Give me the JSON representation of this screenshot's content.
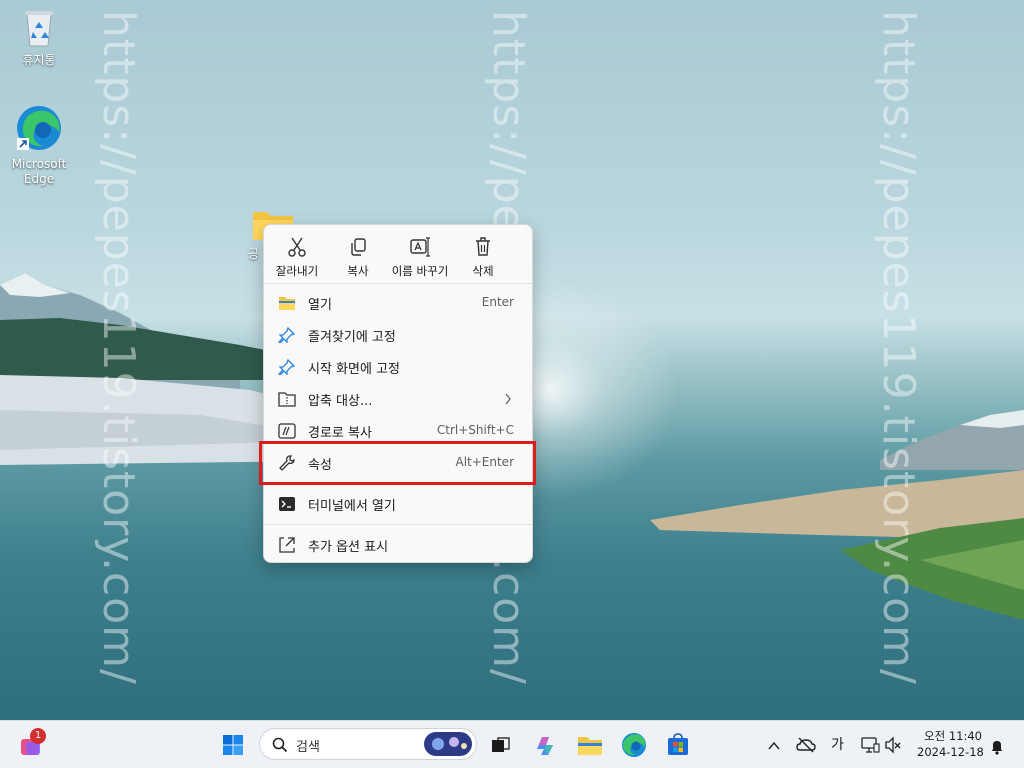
{
  "desktop": {
    "watermark": "https://pepes119.tistory.com/",
    "icons": [
      {
        "label": "휴지통",
        "icon": "recycle-bin-icon"
      },
      {
        "label": "Microsoft Edge",
        "icon": "edge-icon"
      },
      {
        "label": "공",
        "icon": "folder-icon"
      }
    ]
  },
  "context_menu": {
    "quick_actions": [
      {
        "label": "잘라내기",
        "icon": "scissors-icon"
      },
      {
        "label": "복사",
        "icon": "copy-icon"
      },
      {
        "label": "이름 바꾸기",
        "icon": "rename-icon"
      },
      {
        "label": "삭제",
        "icon": "trash-icon"
      }
    ],
    "items": [
      {
        "label": "열기",
        "shortcut": "Enter",
        "icon": "folder-open-icon"
      },
      {
        "label": "즐겨찾기에 고정",
        "shortcut": "",
        "icon": "pin-icon"
      },
      {
        "label": "시작 화면에 고정",
        "shortcut": "",
        "icon": "pin-start-icon"
      },
      {
        "label": "압축 대상...",
        "shortcut": "",
        "icon": "zip-icon",
        "submenu": true
      },
      {
        "label": "경로로 복사",
        "shortcut": "Ctrl+Shift+C",
        "icon": "copy-path-icon"
      },
      {
        "label": "속성",
        "shortcut": "Alt+Enter",
        "icon": "wrench-icon",
        "highlighted": true
      },
      {
        "label": "터미널에서 열기",
        "shortcut": "",
        "icon": "terminal-icon"
      },
      {
        "label": "추가 옵션 표시",
        "shortcut": "",
        "icon": "more-options-icon"
      }
    ]
  },
  "taskbar": {
    "widgets_badge": "1",
    "search_placeholder": "검색",
    "ime_indicator": "가",
    "clock_time": "오전 11:40",
    "clock_date": "2024-12-18"
  },
  "colors": {
    "highlight_border": "#e01b1b",
    "accent": "#0067c0"
  }
}
